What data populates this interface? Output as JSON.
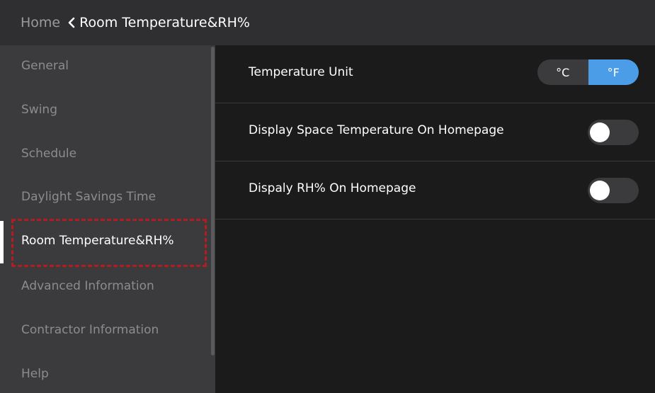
{
  "header": {
    "home_label": "Home",
    "back_icon": "chevron-left-icon",
    "title": "Room Temperature&RH%"
  },
  "sidebar": {
    "items": [
      {
        "label": "General"
      },
      {
        "label": "Swing"
      },
      {
        "label": "Schedule"
      },
      {
        "label": "Daylight Savings Time"
      },
      {
        "label": "Room Temperature&RH%",
        "active": true
      },
      {
        "label": "Advanced Information"
      },
      {
        "label": "Contractor Information"
      },
      {
        "label": "Help"
      }
    ]
  },
  "settings": {
    "temperature_unit": {
      "label": "Temperature Unit",
      "options": [
        "°C",
        "°F"
      ],
      "selected": "°F"
    },
    "display_space_temp": {
      "label": "Display Space Temperature On Homepage",
      "enabled": false
    },
    "display_rh": {
      "label": "Dispaly RH% On Homepage",
      "enabled": false
    }
  },
  "colors": {
    "accent": "#4a9de6",
    "highlight_border": "#b01e22",
    "sidebar_bg": "#3b3b3d",
    "topbar_bg": "#2f2f31",
    "content_bg": "#1b1b1b"
  }
}
